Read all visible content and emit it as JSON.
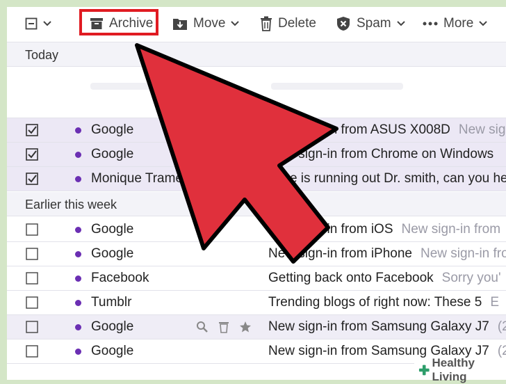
{
  "toolbar": {
    "archive_label": "Archive",
    "move_label": "Move",
    "delete_label": "Delete",
    "spam_label": "Spam",
    "more_label": "More"
  },
  "sections": {
    "today": "Today",
    "earlier": "Earlier this week"
  },
  "emails_today": [
    {
      "sender": "Google",
      "subject": "New sign-in from ASUS X008D",
      "snippet": "New sign",
      "checked": true
    },
    {
      "sender": "Google",
      "subject": "New sign-in from Chrome on Windows",
      "snippet": "",
      "checked": true
    },
    {
      "sender": "Monique Tramel",
      "subject": "Time is running out Dr. smith, can you help",
      "snippet": "",
      "checked": true
    }
  ],
  "emails_earlier": [
    {
      "sender": "Google",
      "subject": "New sign-in from iOS",
      "snippet": "New sign-in from",
      "checked": false
    },
    {
      "sender": "Google",
      "subject": "New sign-in from iPhone",
      "snippet": "New sign-in from",
      "checked": false
    },
    {
      "sender": "Facebook",
      "subject": "Getting back onto Facebook",
      "snippet": "Sorry you'",
      "checked": false
    },
    {
      "sender": "Tumblr",
      "subject": "Trending blogs of right now: These 5",
      "snippet": "E",
      "checked": false
    },
    {
      "sender": "Google",
      "subject": "New sign-in from Samsung Galaxy J7",
      "snippet": "(2",
      "checked": false
    },
    {
      "sender": "Google",
      "subject": "New sign-in from Samsung Galaxy J7",
      "snippet": "(2",
      "checked": false
    }
  ],
  "watermark": "Healthy Living",
  "colors": {
    "highlight_box": "#e01b22",
    "pointer_arrow": "#e0303c",
    "unread_dot": "#6b2fb3",
    "selected_row": "#ece8f5"
  }
}
